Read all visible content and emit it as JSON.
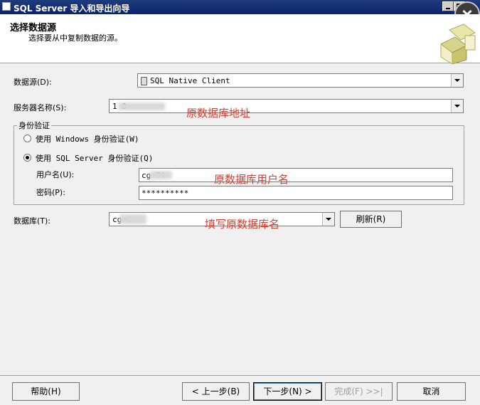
{
  "window": {
    "title": "SQL Server 导入和导出向导"
  },
  "header": {
    "title": "选择数据源",
    "subtitle": "选择要从中复制数据的源。"
  },
  "form": {
    "data_source_label": "数据源(D):",
    "data_source_value": "SQL Native Client",
    "server_label": "服务器名称(S):",
    "server_value": "1 0",
    "auth_group_label": "身份验证",
    "windows_auth_label": "使用 Windows 身份验证(W)",
    "sql_auth_label": "使用 SQL Server 身份验证(Q)",
    "sql_auth_selected": true,
    "username_label": "用户名(U):",
    "username_value": "cg 74",
    "password_label": "密码(P):",
    "password_value": "**********",
    "database_label": "数据库(T):",
    "database_value": "cg 4",
    "refresh_label": "刷新(R)"
  },
  "annotations": {
    "server": "原数据库地址",
    "username": "原数据库用户名",
    "database": "填写原数据库名"
  },
  "footer": {
    "help_label": "帮助(H)",
    "back_label": "< 上一步(B)",
    "next_label": "下一步(N) >",
    "finish_label": "完成(F) >>|",
    "cancel_label": "取消"
  }
}
